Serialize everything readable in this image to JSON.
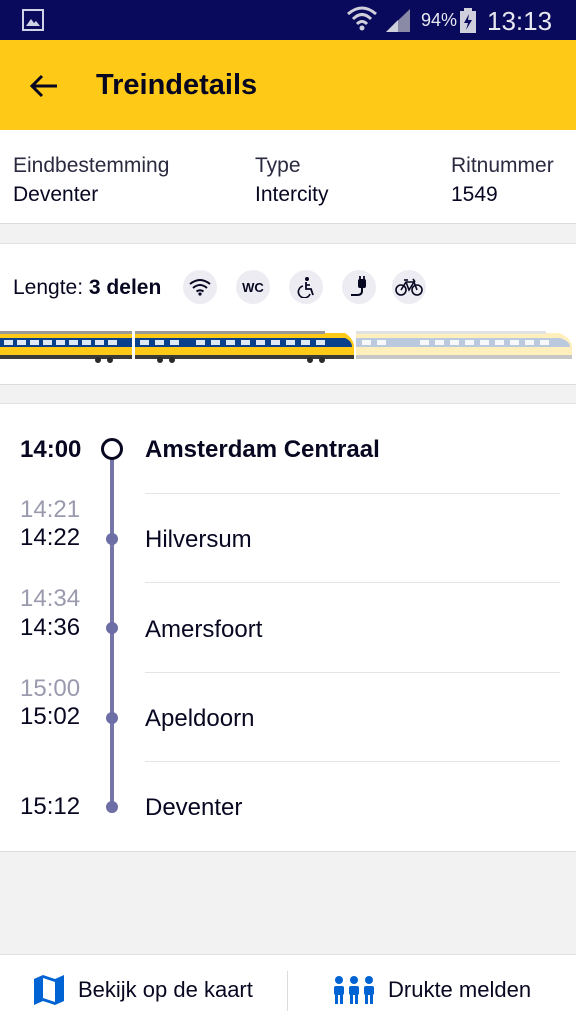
{
  "status_bar": {
    "battery_percent": "94%",
    "time": "13:13",
    "icons": [
      "gallery-icon",
      "wifi-icon",
      "signal-icon",
      "battery-charging-icon"
    ]
  },
  "app_bar": {
    "title": "Treindetails",
    "back_icon": "arrow-left-icon"
  },
  "info": {
    "destination_label": "Eindbestemming",
    "destination_value": "Deventer",
    "type_label": "Type",
    "type_value": "Intercity",
    "trip_label": "Ritnummer",
    "trip_value": "1549"
  },
  "train": {
    "length_label": "Lengte:",
    "length_value": "3 delen",
    "facilities": [
      "wifi-icon",
      "wc-icon",
      "wheelchair-icon",
      "power-socket-icon",
      "bicycle-icon"
    ],
    "wc_text": "WC",
    "colors": {
      "body": "#ffc917",
      "stripe": "#0a3f8c",
      "roof": "#8a8a8a"
    }
  },
  "stops": [
    {
      "planned": "",
      "actual": "14:00",
      "station": "Amsterdam Centraal",
      "emphasis": true
    },
    {
      "planned": "14:21",
      "actual": "14:22",
      "station": "Hilversum",
      "emphasis": false
    },
    {
      "planned": "14:34",
      "actual": "14:36",
      "station": "Amersfoort",
      "emphasis": false
    },
    {
      "planned": "15:00",
      "actual": "15:02",
      "station": "Apeldoorn",
      "emphasis": false
    },
    {
      "planned": "",
      "actual": "15:12",
      "station": "Deventer",
      "emphasis": false
    }
  ],
  "bottom_bar": {
    "map_label": "Bekijk op de kaart",
    "map_icon": "map-icon",
    "crowd_label": "Drukte melden",
    "crowd_icon": "people-icon"
  },
  "colors": {
    "accent": "#ffc917",
    "navy": "#070721",
    "status_bar": "#0a0a5c",
    "route_line": "#7575a8",
    "icon_blue": "#0063d3"
  }
}
